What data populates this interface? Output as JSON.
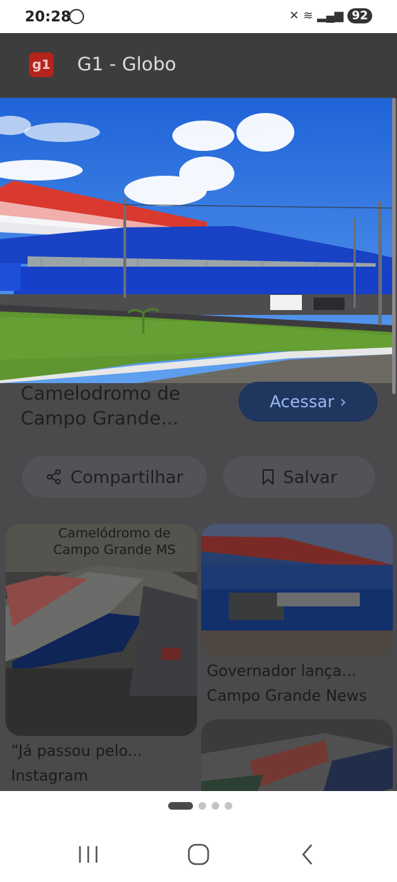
{
  "status_bar": {
    "time": "20:28",
    "battery": "92"
  },
  "header": {
    "logo_text": "g1",
    "title": "G1 - Globo"
  },
  "result": {
    "title": "Camelodromo de Campo Grande...",
    "access_label": "Acessar",
    "share_label": "Compartilhar",
    "save_label": "Salvar"
  },
  "related": [
    {
      "image_overlay_text": "Camelódromo de Campo Grande MS",
      "caption": "“Já passou pelo...",
      "source": "Instagram"
    },
    {
      "caption": "Governador lança...",
      "source": "Campo Grande News"
    }
  ],
  "carousel": {
    "pages": 4,
    "active": 0
  },
  "colors": {
    "header_bg": "#3d3d3d",
    "accent_button": "#20365f",
    "brand_red": "#b3241c"
  }
}
